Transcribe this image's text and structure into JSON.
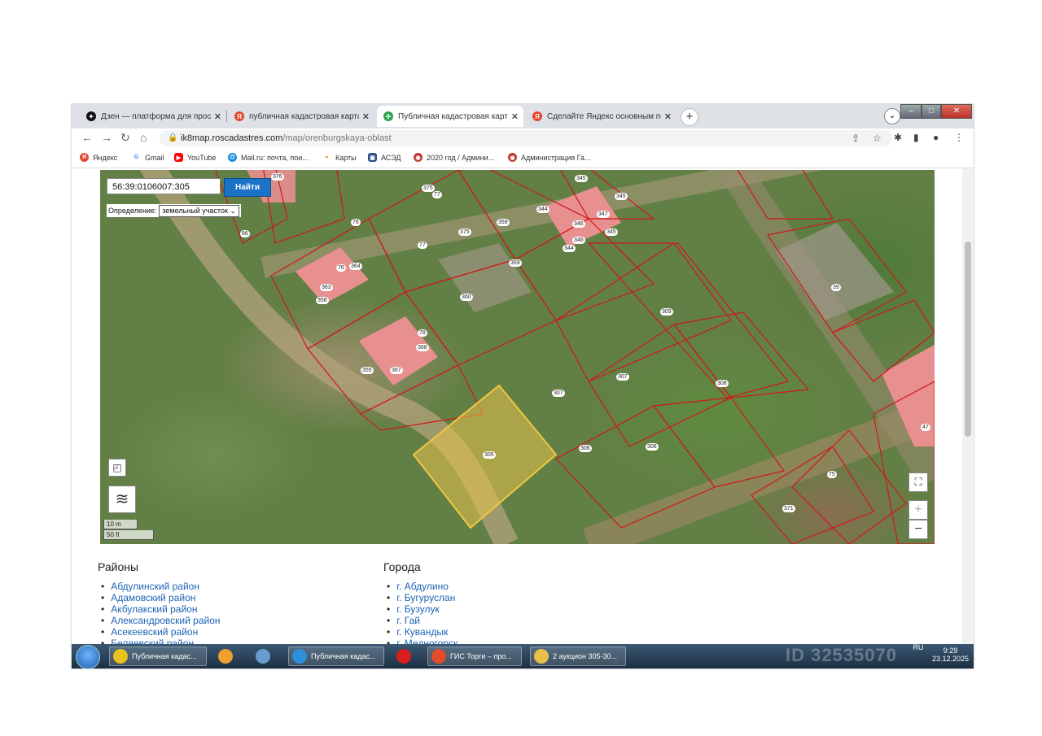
{
  "tabs": [
    {
      "title": "Дзен — платформа для просмотр",
      "favicon_color": "#111111",
      "favicon_glyph": "✦"
    },
    {
      "title": "публичная кадастровая карта ор",
      "favicon_color": "#e4472c",
      "favicon_glyph": "Я"
    },
    {
      "title": "Публичная кадастровая карта Ор",
      "favicon_color": "#2ba24c",
      "favicon_glyph": "✣"
    },
    {
      "title": "Сделайте Яндекс основным поис",
      "favicon_color": "#e4472c",
      "favicon_glyph": "Я"
    }
  ],
  "tab_close": "✕",
  "new_tab": "+",
  "address": {
    "host": "ik8map.roscadastres.com",
    "path": "/map/orenburgskaya-oblast"
  },
  "bookmarks": [
    {
      "label": "Яндекс",
      "color": "#e4472c",
      "glyph": "Я"
    },
    {
      "label": "Gmail",
      "color": "#4285f4",
      "glyph": "G"
    },
    {
      "label": "YouTube",
      "color": "#ff0000",
      "glyph": "▶"
    },
    {
      "label": "Mail.ru: почта, пои...",
      "color": "#168de2",
      "glyph": "@"
    },
    {
      "label": "Карты",
      "color": "#f5a623",
      "glyph": "●"
    },
    {
      "label": "АСЭД",
      "color": "#2d4e8a",
      "glyph": "▣"
    },
    {
      "label": "2020 год / Админи...",
      "color": "#c0392b",
      "glyph": "◉"
    },
    {
      "label": "Администрация Га...",
      "color": "#c0392b",
      "glyph": "◉"
    }
  ],
  "map": {
    "search_value": "56:39:0106007:305",
    "search_button": "Найти",
    "definition_label": "Определение:",
    "definition_value": "земельный участок",
    "scale_m": "10 m",
    "scale_ft": "50 ft",
    "zoom_in": "+",
    "zoom_out": "−",
    "fullscreen": "⛶",
    "parcel_labels": [
      "376",
      "375",
      "77",
      "345",
      "345",
      "344",
      "346",
      "346",
      "344",
      "345",
      "347",
      "76",
      "359",
      "66",
      "77",
      "375",
      "364",
      "76",
      "359",
      "363",
      "358",
      "360",
      "78",
      "368",
      "355",
      "367",
      "309",
      "39",
      "307",
      "307",
      "308",
      "47",
      "305",
      "306",
      "306",
      "75",
      "371"
    ]
  },
  "districts": {
    "heading": "Районы",
    "items": [
      "Абдулинский район",
      "Адамовский район",
      "Акбулакский район",
      "Александровский район",
      "Асекеевский район",
      "Беляевский район"
    ]
  },
  "cities": {
    "heading": "Города",
    "items": [
      "г. Абдулино",
      "г. Бугуруслан",
      "г. Бузулук",
      "г. Гай",
      "г. Кувандык",
      "г. Медногорск"
    ]
  },
  "taskbar": {
    "items": [
      {
        "label": "Публичная кадас...",
        "color": "#e8c21c"
      },
      {
        "label": "",
        "color": "#f0a030"
      },
      {
        "label": "",
        "color": "#6a9bd1"
      },
      {
        "label": "Публичная кадас...",
        "color": "#2b8fd9"
      },
      {
        "label": "",
        "color": "#d81e1e"
      },
      {
        "label": "ГИС Торги – про...",
        "color": "#e44b2c"
      },
      {
        "label": "2 аукцион 305-30...",
        "color": "#e8c04a"
      }
    ],
    "lang": "RU",
    "time": "9:29",
    "date": "23.12.2025"
  },
  "watermark": "ID 32535070"
}
